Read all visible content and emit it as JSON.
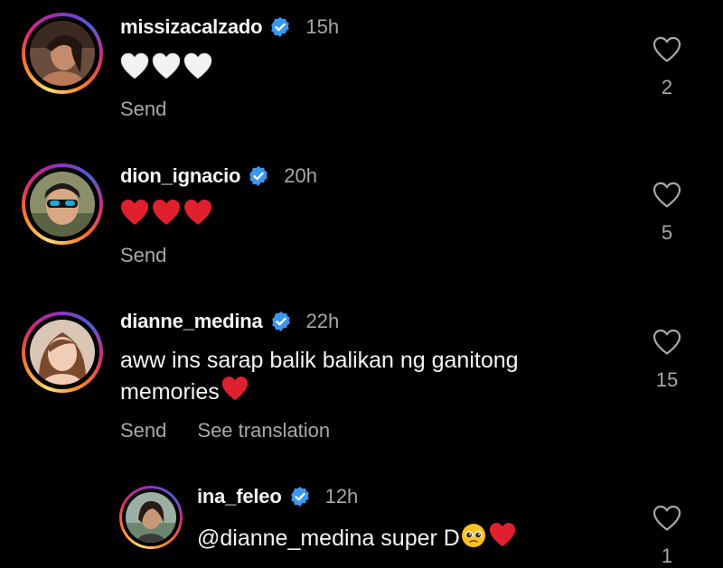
{
  "comments": [
    {
      "username": "missizacalzado",
      "verified": true,
      "time": "15h",
      "text": "",
      "emoji": [
        "white-heart",
        "white-heart",
        "white-heart"
      ],
      "actions": [
        "Send"
      ],
      "likes": "2"
    },
    {
      "username": "dion_ignacio",
      "verified": true,
      "time": "20h",
      "text": "",
      "emoji": [
        "red-heart",
        "red-heart",
        "red-heart"
      ],
      "actions": [
        "Send"
      ],
      "likes": "5"
    },
    {
      "username": "dianne_medina",
      "verified": true,
      "time": "22h",
      "text_line1": "aww ins sarap balik balikan ng ganitong",
      "text_line2": "memories",
      "emoji_after": "red-heart",
      "actions": [
        "Send",
        "See translation"
      ],
      "likes": "15"
    },
    {
      "username": "ina_feleo",
      "verified": true,
      "time": "12h",
      "text": "@dianne_medina super D",
      "emoji_after": [
        "pleading-face",
        "red-heart"
      ],
      "likes": "1"
    }
  ],
  "colors": {
    "background": "#000000",
    "text": "#f5f5f5",
    "secondary": "#a8a8a8",
    "verified": "#3897f0",
    "red_heart": "#e0202e",
    "white_heart": "#f2f2f2"
  }
}
